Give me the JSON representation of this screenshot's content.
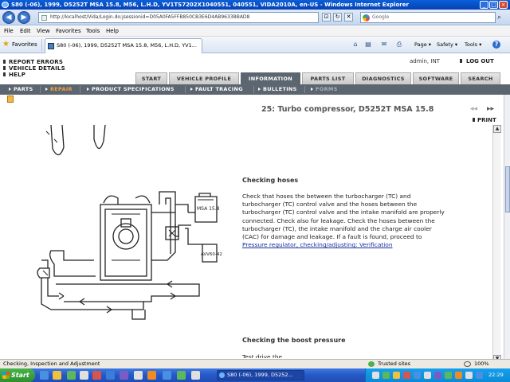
{
  "window": {
    "title": "S80 (-06), 1999, D5252T MSA 15.8, M56, L.H.D, YV1TS7202X1040551, 040551, VIDA2010A, en-US - Windows Internet Explorer",
    "minimize": "_",
    "maximize": "□",
    "close": "×"
  },
  "address_bar": {
    "back": "◀",
    "forward": "▶",
    "url": "http://localhost/Vida/Login.do;jsessionid=D05A0FA5FFB850CB3E6D4AB9633BBAD8",
    "compat": "⊡",
    "refresh": "↻",
    "stop": "✕",
    "search_placeholder": "Google",
    "search_go": "⌕"
  },
  "menu": [
    "File",
    "Edit",
    "View",
    "Favorites",
    "Tools",
    "Help"
  ],
  "favorites_bar": {
    "favorites_label": "Favorites",
    "tab_label": "S80 (-06), 1999, D5252T MSA 15.8, M56, L.H.D, YV1...",
    "commands": [
      "Page ▾",
      "Safety ▾",
      "Tools ▾"
    ],
    "command_icons": [
      "⌂",
      "▤",
      "✉",
      "⎙"
    ],
    "help_icon": "?"
  },
  "app": {
    "top_links": [
      "REPORT ERRORS",
      "VEHICLE DETAILS",
      "HELP"
    ],
    "user": "admin, INT",
    "logout": "LOG OUT",
    "main_tabs": [
      "START",
      "VEHICLE PROFILE",
      "INFORMATION",
      "PARTS LIST",
      "DIAGNOSTICS",
      "SOFTWARE",
      "SEARCH"
    ],
    "active_main_tab": "INFORMATION",
    "sub_nav": [
      "PARTS",
      "REPAIR",
      "PRODUCT SPECIFICATIONS",
      "FAULT TRACING",
      "BULLETINS",
      "FORMS"
    ],
    "active_sub_nav": "REPAIR"
  },
  "document": {
    "title": "25: Turbo compressor, D5252T MSA 15.8",
    "prev": "◂◂",
    "next": "▸▸",
    "print": "PRINT",
    "section1_heading": "Checking hoses",
    "section1_text": "Check that hoses the between the turbocharger (TC) and turbocharger (TC) control valve and the hoses between the turbocharger (TC) control valve and the intake manifold are properly connected. Check also for leakage. Check the hoses between the turbocharger (TC), the intake manifold and the charge air cooler (CAC) for damage and leakage. If a fault is found, proceed to ",
    "section1_link": "Pressure regulator, checking/adjusting: Verification",
    "section2_heading": "Checking the boost pressure",
    "section2_partial": "Test drive the",
    "diagram_labels": [
      "MSA 15.8",
      "AVV60-42"
    ]
  },
  "status_bar": {
    "left": "Checking, Inspection and Adjustment",
    "zone": "Trusted sites",
    "zoom": "100%"
  },
  "taskbar": {
    "start": "Start",
    "task": "S80 (-06), 1999, D5252...",
    "clock": "22:29"
  },
  "colors": {
    "titlebar": "#0641b4",
    "nav_dark": "#5c6670",
    "active_subnav": "#f0a040",
    "link": "#1a2c9c",
    "taskbar": "#2657c4"
  }
}
